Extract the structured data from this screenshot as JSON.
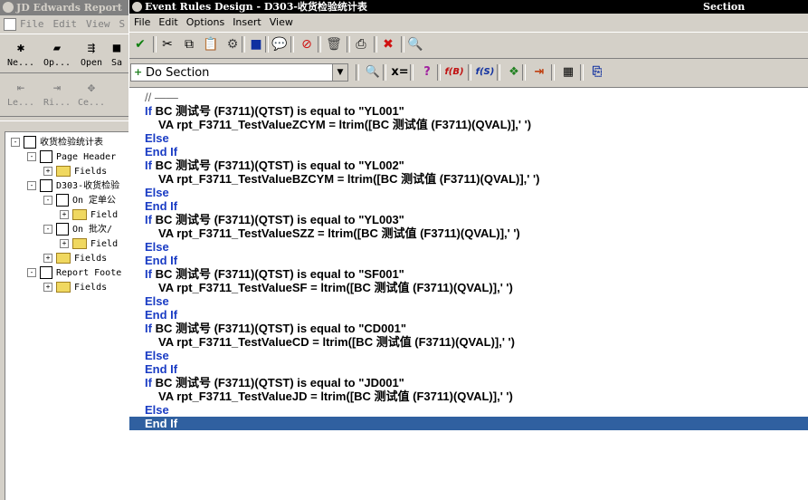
{
  "back_window": {
    "title": "JD Edwards Report",
    "menu": [
      "File",
      "Edit",
      "View",
      "S"
    ],
    "toolbar1": [
      {
        "label": "Ne...",
        "icon": "new-icon"
      },
      {
        "label": "Op...",
        "icon": "open-folder-icon"
      },
      {
        "label": "Open",
        "icon": "open-icon"
      },
      {
        "label": "Sa",
        "icon": "save-icon"
      }
    ],
    "toolbar2": [
      {
        "label": "Le...",
        "icon": "align-left-icon"
      },
      {
        "label": "Ri...",
        "icon": "align-right-icon"
      },
      {
        "label": "Ce...",
        "icon": "align-center-icon"
      }
    ],
    "tree": [
      {
        "label": "收货检验统计表",
        "box": "-",
        "icon": "doc",
        "indent": 0
      },
      {
        "label": "Page Header",
        "box": "-",
        "icon": "doc",
        "indent": 1
      },
      {
        "label": "Fields",
        "box": "+",
        "icon": "folder",
        "indent": 2
      },
      {
        "label": "D303-收货检验",
        "box": "-",
        "icon": "doc",
        "indent": 1
      },
      {
        "label": "On 定单公",
        "box": "-",
        "icon": "doc",
        "indent": 2
      },
      {
        "label": "Field",
        "box": "+",
        "icon": "folder",
        "indent": 3
      },
      {
        "label": "On 批次/",
        "box": "-",
        "icon": "doc",
        "indent": 2
      },
      {
        "label": "Field",
        "box": "+",
        "icon": "folder",
        "indent": 3
      },
      {
        "label": "Fields",
        "box": "+",
        "icon": "folder",
        "indent": 2
      },
      {
        "label": "Report Foote",
        "box": "-",
        "icon": "doc",
        "indent": 1
      },
      {
        "label": "Fields",
        "box": "+",
        "icon": "folder",
        "indent": 2
      }
    ]
  },
  "front_window": {
    "title": "Event Rules Design - D303-收货检验统计表",
    "section_label": "Section",
    "menu": [
      "File",
      "Edit",
      "Options",
      "Insert",
      "View"
    ],
    "toolbar_icons": [
      {
        "name": "check-icon",
        "glyph": "✔",
        "color": "#108010"
      },
      {
        "name": "cut-icon",
        "glyph": "✂",
        "color": "#000000"
      },
      {
        "name": "copy-icon",
        "glyph": "⧉",
        "color": "#000000"
      },
      {
        "name": "paste-icon",
        "glyph": "📋",
        "color": "#000000"
      },
      {
        "name": "find-icon",
        "glyph": "⚙",
        "color": "#404040"
      },
      {
        "name": "save-icon",
        "glyph": "■",
        "color": "#1030a0"
      },
      {
        "name": "comment-icon",
        "glyph": "💬",
        "color": "#000000"
      },
      {
        "name": "disable-icon",
        "glyph": "⊘",
        "color": "#d01010"
      },
      {
        "name": "delete-icon",
        "glyph": "🗑",
        "color": "#404040"
      },
      {
        "name": "print-icon",
        "glyph": "⎙",
        "color": "#000000"
      },
      {
        "name": "cancel-icon",
        "glyph": "✖",
        "color": "#d01010"
      },
      {
        "name": "search-icon",
        "glyph": "🔍",
        "color": "#000000"
      }
    ],
    "section_select": {
      "value": "Do Section"
    },
    "toolbar2_icons": [
      {
        "name": "zoom-icon",
        "glyph": "🔍",
        "color": "#000000"
      },
      {
        "name": "assign-icon",
        "glyph": "x=",
        "color": "#000000"
      },
      {
        "name": "if-icon",
        "glyph": "?",
        "color": "#a020a0"
      },
      {
        "name": "function-business-icon",
        "glyph": "f(B)",
        "color": "#c01010"
      },
      {
        "name": "function-system-icon",
        "glyph": "f(S)",
        "color": "#1030a0"
      },
      {
        "name": "variables-icon",
        "glyph": "❖",
        "color": "#208020"
      },
      {
        "name": "insert-icon",
        "glyph": "⇥",
        "color": "#c04010"
      },
      {
        "name": "table-icon",
        "glyph": "▦",
        "color": "#000000"
      },
      {
        "name": "copy-lines-icon",
        "glyph": "⎘",
        "color": "#1030a0"
      }
    ],
    "editor": {
      "lines": [
        {
          "kw": "",
          "text": "// ——",
          "indent": 0,
          "comment": true
        },
        {
          "kw": "If",
          "text": " BC 测试号 (F3711)(QTST) is equal to \"YL001\"",
          "indent": 0
        },
        {
          "kw": "",
          "text": "VA rpt_F3711_TestValueZCYM = ltrim([BC 测试值 (F3711)(QVAL)],' ')",
          "indent": 1
        },
        {
          "kw": "Else",
          "text": "",
          "indent": 0
        },
        {
          "kw": "End If",
          "text": "",
          "indent": 0
        },
        {
          "kw": "If",
          "text": " BC 测试号 (F3711)(QTST) is equal to \"YL002\"",
          "indent": 0
        },
        {
          "kw": "",
          "text": "VA rpt_F3711_TestValueBZCYM = ltrim([BC 测试值 (F3711)(QVAL)],' ')",
          "indent": 1
        },
        {
          "kw": "Else",
          "text": "",
          "indent": 0
        },
        {
          "kw": "End If",
          "text": "",
          "indent": 0
        },
        {
          "kw": "If",
          "text": " BC 测试号 (F3711)(QTST) is equal to \"YL003\"",
          "indent": 0
        },
        {
          "kw": "",
          "text": "VA rpt_F3711_TestValueSZZ = ltrim([BC 测试值 (F3711)(QVAL)],' ')",
          "indent": 1
        },
        {
          "kw": "Else",
          "text": "",
          "indent": 0
        },
        {
          "kw": "End If",
          "text": "",
          "indent": 0
        },
        {
          "kw": "If",
          "text": " BC 测试号 (F3711)(QTST) is equal to \"SF001\"",
          "indent": 0
        },
        {
          "kw": "",
          "text": "VA rpt_F3711_TestValueSF = ltrim([BC 测试值 (F3711)(QVAL)],' ')",
          "indent": 1
        },
        {
          "kw": "Else",
          "text": "",
          "indent": 0
        },
        {
          "kw": "End If",
          "text": "",
          "indent": 0
        },
        {
          "kw": "If",
          "text": " BC 测试号 (F3711)(QTST) is equal to \"CD001\"",
          "indent": 0
        },
        {
          "kw": "",
          "text": "VA rpt_F3711_TestValueCD = ltrim([BC 测试值 (F3711)(QVAL)],' ')",
          "indent": 1
        },
        {
          "kw": "Else",
          "text": "",
          "indent": 0
        },
        {
          "kw": "End If",
          "text": "",
          "indent": 0
        },
        {
          "kw": "If",
          "text": " BC 测试号 (F3711)(QTST) is equal to \"JD001\"",
          "indent": 0
        },
        {
          "kw": "",
          "text": "VA rpt_F3711_TestValueJD = ltrim([BC 测试值 (F3711)(QVAL)],' ')",
          "indent": 1
        },
        {
          "kw": "Else",
          "text": "",
          "indent": 0
        },
        {
          "kw": "End If",
          "text": "",
          "indent": 0,
          "selected": true
        }
      ]
    }
  }
}
